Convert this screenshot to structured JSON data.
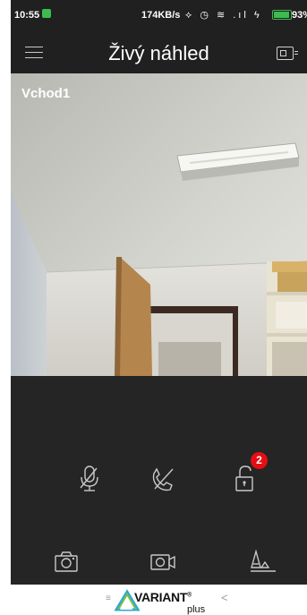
{
  "status_bar": {
    "time": "10:55",
    "network_speed": "174KB/s",
    "status_icons": "⟡ ◷ ≋ .ıl ϟ",
    "battery_percent": "93%"
  },
  "header": {
    "title": "Živý náhled",
    "menu_icon": "hamburger-menu-icon",
    "device_icon": "intercom-device-icon"
  },
  "video": {
    "camera_label": "Vchod1"
  },
  "controls": {
    "unlock_badge_count": "2",
    "mute_icon": "microphone-off-icon",
    "hangup_icon": "phone-off-icon",
    "unlock_icon": "unlock-icon",
    "snapshot_icon": "camera-icon",
    "record_icon": "video-record-icon",
    "image_icon": "image-adjust-icon"
  },
  "footer": {
    "brand": "VARIANT",
    "registered_mark": "®",
    "sub_brand": "plus"
  },
  "colors": {
    "background": "#1f1f1f",
    "badge": "#e60e14",
    "battery": "#3dbb50"
  }
}
